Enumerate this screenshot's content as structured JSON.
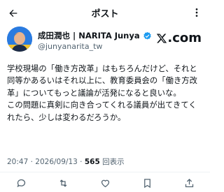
{
  "header": {
    "title": "ポスト",
    "back_icon": "arrow-left-icon",
    "more_icon": "dots-vertical-icon"
  },
  "author": {
    "name": "成田潤也 | NARITA Junya",
    "handle": "@junyanarita_tw",
    "verified": true,
    "verified_color": "#1d9bf0",
    "avatar_icon": "avatar-photo"
  },
  "brand": {
    "logo_text": ".com",
    "logo_icon": "x-logo-icon"
  },
  "post": {
    "paragraphs": [
      "学校現場の「働き方改革」はもちろんだけど、それと同等かあるいはそれ以上に、教育委員会の「働き方改革」についてもっと議論が活発になると良いな。",
      "この問題に真剣に向き合ってくれる議員が出てきてくれたら、少しは変わるだろうか。"
    ]
  },
  "meta": {
    "time": "20:47",
    "date": "2026/09/13",
    "views_count": "565",
    "views_label": "回表示"
  },
  "colors": {
    "text": "#0f1419",
    "secondary": "#536471",
    "accent": "#1d9bf0"
  }
}
